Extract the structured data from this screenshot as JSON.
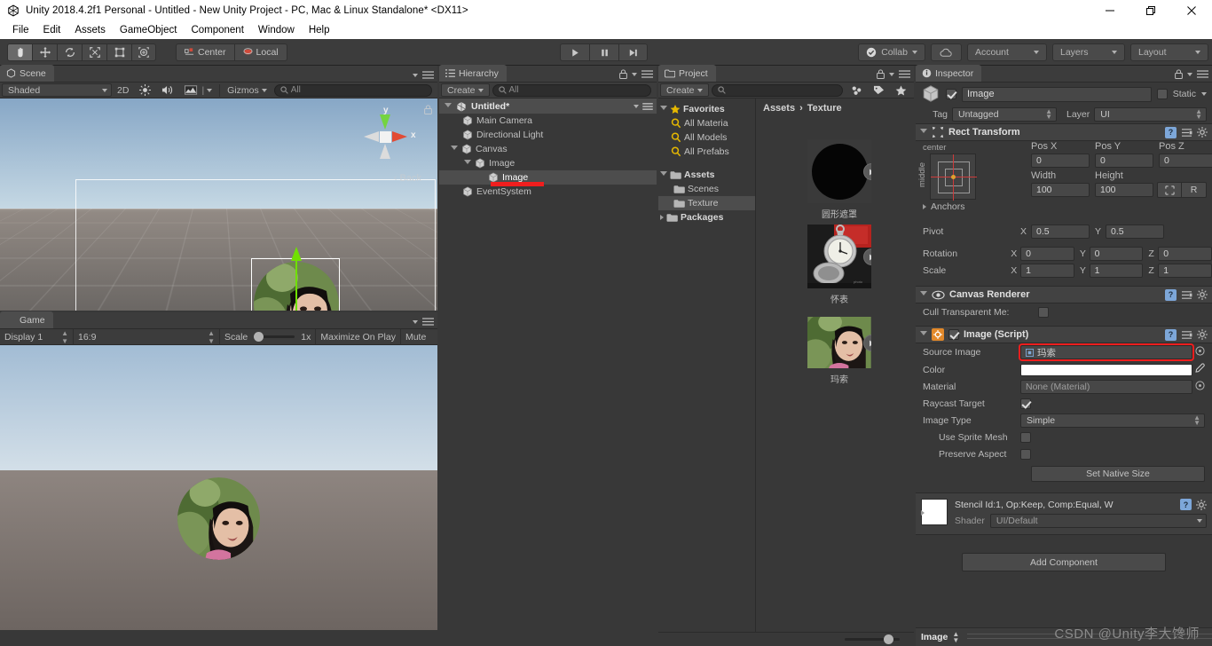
{
  "window": {
    "title": "Unity 2018.4.2f1 Personal - Untitled - New Unity Project - PC, Mac & Linux Standalone* <DX11>",
    "minimize": "minimize-icon",
    "maximize": "maximize-icon",
    "close": "close-icon"
  },
  "menubar": {
    "items": [
      "File",
      "Edit",
      "Assets",
      "GameObject",
      "Component",
      "Window",
      "Help"
    ]
  },
  "toolbar": {
    "tools": [
      "hand-tool",
      "move-tool",
      "rotate-tool",
      "scale-tool",
      "rect-tool",
      "transform-tool"
    ],
    "pivot_mode": "Center",
    "pivot_rotation": "Local",
    "play": "play-icon",
    "pause": "pause-icon",
    "step": "step-icon",
    "collab": "Collab",
    "cloud": "cloud-icon",
    "account": "Account",
    "layers": "Layers",
    "layout": "Layout"
  },
  "scene": {
    "tab": "Scene",
    "draw_mode": "Shaded",
    "mode_2d": "2D",
    "lighting": "lighting-icon",
    "audio": "audio-icon",
    "fx": "fx-icon",
    "gizmos": "Gizmos",
    "search_placeholder": "All",
    "gizmo_axes": {
      "y": "y",
      "x": "x"
    },
    "view_label": "Back"
  },
  "game": {
    "tab": "Game",
    "display": "Display 1",
    "aspect": "16:9",
    "scale_label": "Scale",
    "scale_value": "1x",
    "maximize": "Maximize On Play",
    "mute": "Mute"
  },
  "hierarchy": {
    "tab": "Hierarchy",
    "create": "Create",
    "search_placeholder": "All",
    "scene_name": "Untitled*",
    "items": [
      {
        "label": "Main Camera",
        "depth": 1,
        "expandable": false,
        "selected": false
      },
      {
        "label": "Directional Light",
        "depth": 1,
        "expandable": false,
        "selected": false
      },
      {
        "label": "Canvas",
        "depth": 1,
        "expandable": true,
        "selected": false
      },
      {
        "label": "Image",
        "depth": 2,
        "expandable": true,
        "selected": false
      },
      {
        "label": "Image",
        "depth": 3,
        "expandable": false,
        "selected": true
      },
      {
        "label": "EventSystem",
        "depth": 1,
        "expandable": false,
        "selected": false
      }
    ]
  },
  "project": {
    "tab": "Project",
    "create": "Create",
    "search_placeholder": "",
    "breadcrumb": [
      "Assets",
      "Texture"
    ],
    "tree": [
      {
        "label": "Favorites",
        "type": "favorites",
        "depth": 0,
        "expandable": true,
        "selected": false
      },
      {
        "label": "All Materia",
        "type": "search",
        "depth": 1,
        "expandable": false,
        "selected": false
      },
      {
        "label": "All Models",
        "type": "search",
        "depth": 1,
        "expandable": false,
        "selected": false
      },
      {
        "label": "All Prefabs",
        "type": "search",
        "depth": 1,
        "expandable": false,
        "selected": false
      },
      {
        "label": "Assets",
        "type": "folder",
        "depth": 0,
        "expandable": true,
        "selected": false
      },
      {
        "label": "Scenes",
        "type": "folder",
        "depth": 1,
        "expandable": false,
        "selected": false
      },
      {
        "label": "Texture",
        "type": "folder",
        "depth": 1,
        "expandable": false,
        "selected": true
      },
      {
        "label": "Packages",
        "type": "folder",
        "depth": 0,
        "expandable": true,
        "selected": false
      }
    ],
    "assets": [
      {
        "name": "圆形遮罩",
        "kind": "circle-mask"
      },
      {
        "name": "怀表",
        "kind": "pocket-watch"
      },
      {
        "name": "玛索",
        "kind": "portrait"
      }
    ]
  },
  "inspector": {
    "tab": "Inspector",
    "object_name": "Image",
    "object_enabled": true,
    "static_label": "Static",
    "tag_label": "Tag",
    "tag_value": "Untagged",
    "layer_label": "Layer",
    "layer_value": "UI",
    "rect_transform": {
      "title": "Rect Transform",
      "anchor_preset_h": "center",
      "anchor_preset_v": "middle",
      "pos_x_label": "Pos X",
      "pos_x": "0",
      "pos_y_label": "Pos Y",
      "pos_y": "0",
      "pos_z_label": "Pos Z",
      "pos_z": "0",
      "width_label": "Width",
      "width": "100",
      "height_label": "Height",
      "height": "100",
      "blueprint_btn": "blueprint-icon",
      "raw_btn": "R",
      "anchors_label": "Anchors",
      "pivot_label": "Pivot",
      "pivot_x": "0.5",
      "pivot_y": "0.5",
      "rotation_label": "Rotation",
      "rot_x": "0",
      "rot_y": "0",
      "rot_z": "0",
      "scale_label": "Scale",
      "scale_x": "1",
      "scale_y": "1",
      "scale_z": "1"
    },
    "canvas_renderer": {
      "title": "Canvas Renderer",
      "cull_label": "Cull Transparent Me:",
      "cull_value": false
    },
    "image_script": {
      "title": "Image (Script)",
      "enabled": true,
      "source_image_label": "Source Image",
      "source_image_value": "玛索",
      "color_label": "Color",
      "color_value": "#FFFFFF",
      "material_label": "Material",
      "material_value": "None (Material)",
      "raycast_label": "Raycast Target",
      "raycast_value": true,
      "image_type_label": "Image Type",
      "image_type_value": "Simple",
      "use_sprite_mesh_label": "Use Sprite Mesh",
      "use_sprite_mesh_value": false,
      "preserve_aspect_label": "Preserve Aspect",
      "preserve_aspect_value": false,
      "set_native_size": "Set Native Size"
    },
    "material": {
      "title": "Stencil Id:1, Op:Keep, Comp:Equal, W",
      "shader_label": "Shader",
      "shader_value": "UI/Default"
    },
    "add_component": "Add Component",
    "footer_name": "Image"
  },
  "watermark": "CSDN @Unity李大馋师",
  "colors": {
    "panel_bg": "#383838",
    "header_bg": "#3c3c3c",
    "selection": "#4d4d4d",
    "accent_red": "#f01e1e",
    "accent_green": "#70e000",
    "favorites_star": "#e6b800"
  }
}
